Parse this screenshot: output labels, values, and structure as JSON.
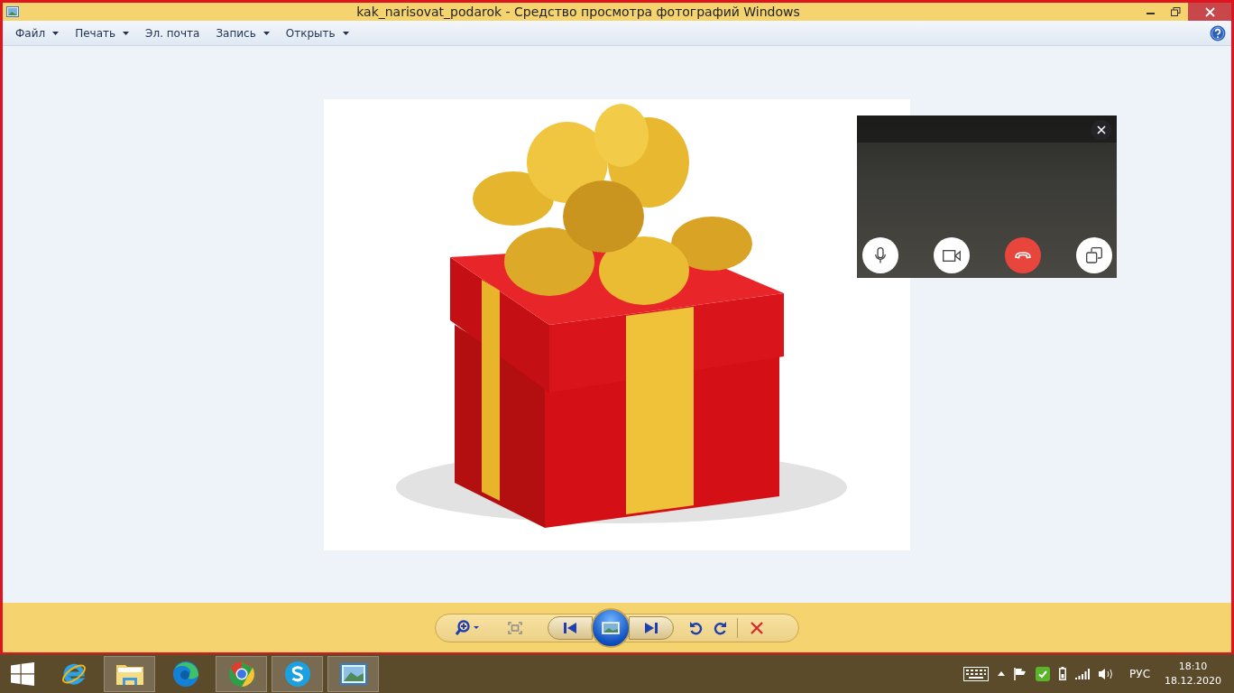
{
  "window": {
    "title": "kak_narisovat_podarok - Средство просмотра фотографий Windows",
    "controls": [
      {
        "kind": "minimize"
      },
      {
        "kind": "maximize"
      },
      {
        "kind": "close"
      }
    ]
  },
  "menu": [
    {
      "label": "Файл",
      "dropdown": true
    },
    {
      "label": "Печать",
      "dropdown": true
    },
    {
      "label": "Эл. почта",
      "dropdown": false
    },
    {
      "label": "Запись",
      "dropdown": true
    },
    {
      "label": "Открыть",
      "dropdown": true
    }
  ],
  "toolbar": [
    {
      "kind": "zoom"
    },
    {
      "kind": "fit"
    },
    {
      "kind": "previous"
    },
    {
      "kind": "slideshow"
    },
    {
      "kind": "next"
    },
    {
      "kind": "rotate-left"
    },
    {
      "kind": "rotate-right"
    },
    {
      "kind": "divider"
    },
    {
      "kind": "delete"
    }
  ],
  "video_call": {
    "buttons": [
      {
        "kind": "mic"
      },
      {
        "kind": "camera"
      },
      {
        "kind": "hangup"
      },
      {
        "kind": "popout"
      }
    ]
  },
  "taskbar": {
    "apps": [
      {
        "kind": "ie",
        "running": false
      },
      {
        "kind": "explorer",
        "running": true
      },
      {
        "kind": "edge",
        "running": false
      },
      {
        "kind": "chrome",
        "running": true
      },
      {
        "kind": "skype",
        "running": true
      },
      {
        "kind": "photos",
        "running": true
      }
    ],
    "tray": {
      "language": "РУС",
      "time": "18:10",
      "date": "18.12.2020"
    }
  }
}
